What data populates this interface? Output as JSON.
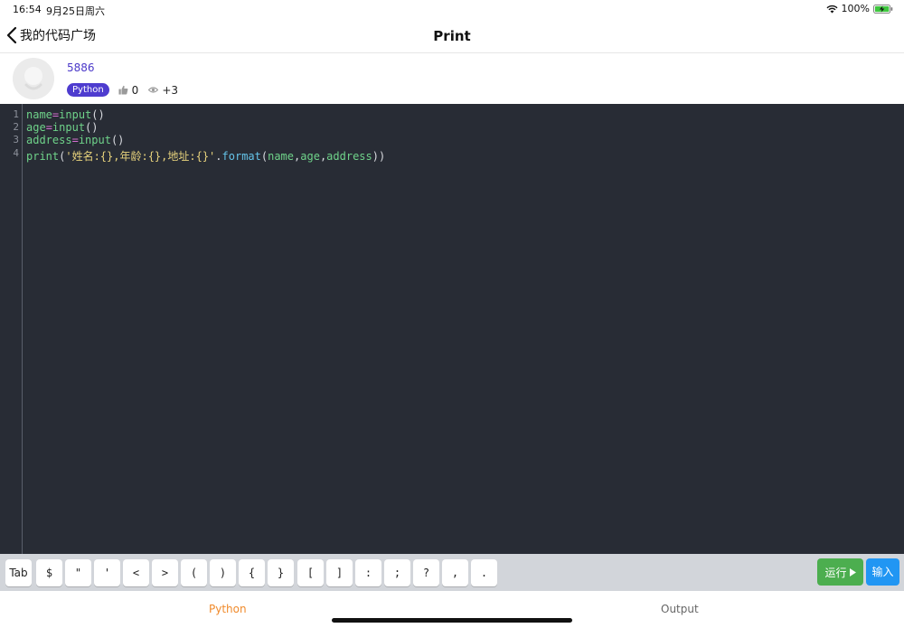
{
  "status": {
    "time": "16:54",
    "date": "9月25日周六",
    "battery": "100%"
  },
  "nav": {
    "back_label": "我的代码广场",
    "title": "Print"
  },
  "author": {
    "name": "5886",
    "language": "Python",
    "likes": "0",
    "views": "+3"
  },
  "editor": {
    "line_numbers": [
      "1",
      "2",
      "3",
      "4"
    ],
    "lines": [
      [
        {
          "t": "name",
          "k": "id"
        },
        {
          "t": "=",
          "k": "op"
        },
        {
          "t": "input",
          "k": "id"
        },
        {
          "t": "()",
          "k": "p"
        }
      ],
      [
        {
          "t": "age",
          "k": "id"
        },
        {
          "t": "=",
          "k": "op"
        },
        {
          "t": "input",
          "k": "id"
        },
        {
          "t": "()",
          "k": "p"
        }
      ],
      [
        {
          "t": "address",
          "k": "id"
        },
        {
          "t": "=",
          "k": "op"
        },
        {
          "t": "input",
          "k": "id"
        },
        {
          "t": "()",
          "k": "p"
        }
      ],
      [
        {
          "t": "print",
          "k": "id"
        },
        {
          "t": "(",
          "k": "p"
        },
        {
          "t": "'姓名:{},年龄:{},地址:{}'",
          "k": "str"
        },
        {
          "t": ".",
          "k": "p"
        },
        {
          "t": "format",
          "k": "fn"
        },
        {
          "t": "(",
          "k": "p"
        },
        {
          "t": "name",
          "k": "id"
        },
        {
          "t": ",",
          "k": "p"
        },
        {
          "t": "age",
          "k": "id"
        },
        {
          "t": ",",
          "k": "p"
        },
        {
          "t": "address",
          "k": "id"
        },
        {
          "t": "))",
          "k": "p"
        }
      ]
    ]
  },
  "keys": [
    "Tab",
    "$",
    "\"",
    "'",
    "<",
    ">",
    "(",
    ")",
    "{",
    "}",
    "[",
    "]",
    ":",
    ";",
    "?",
    ",",
    "."
  ],
  "actions": {
    "run": "运行",
    "input": "输入"
  },
  "tabs": {
    "python": "Python",
    "output": "Output"
  },
  "colors": {
    "accent_purple": "#4e3ccf",
    "run_green": "#4cae4f",
    "input_blue": "#2196f3",
    "active_tab": "#f08a2b",
    "editor_bg": "#282c35"
  }
}
